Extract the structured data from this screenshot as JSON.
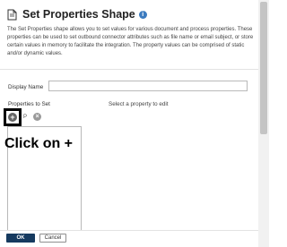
{
  "dialog": {
    "title": "Set Properties Shape",
    "info_icon": "i",
    "description": "The Set Properties shape allows you to set values for various document and process properties. These properties can be used to set outbound connector attributes such as file name or email subject, or store certain values in memory to facilitate the integration. The property values can be comprised of static and/or dynamic values."
  },
  "form": {
    "display_name_label": "Display Name",
    "display_name_value": "",
    "properties_to_set_label": "Properties to Set",
    "select_property_hint": "Select a property to edit",
    "add_symbol": "+",
    "remove_symbol": "×",
    "small_label": "P"
  },
  "annotation": {
    "text": "Click on +"
  },
  "footer": {
    "ok_label": "OK",
    "cancel_label": "Cancel"
  },
  "colors": {
    "ok_button_bg": "#163a5f",
    "info_icon": "#3b7bbf",
    "highlight_border": "#000000"
  }
}
